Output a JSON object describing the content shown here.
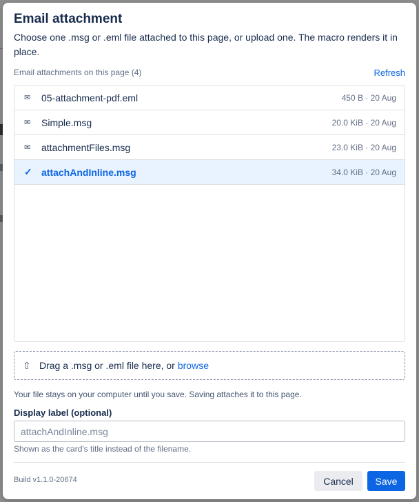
{
  "dialog": {
    "title": "Email attachment",
    "description": "Choose one .msg or .eml file attached to this page, or upload one. The macro renders it in place."
  },
  "attachments": {
    "caption": "Email attachments on this page (4)",
    "refresh_label": "Refresh",
    "items": [
      {
        "icon": "mail-icon",
        "glyph": "✉",
        "name": "05-attachment-pdf.eml",
        "meta": "450 B · 20 Aug",
        "selected": false
      },
      {
        "icon": "mail-icon",
        "glyph": "✉",
        "name": "Simple.msg",
        "meta": "20.0 KiB · 20 Aug",
        "selected": false
      },
      {
        "icon": "mail-icon",
        "glyph": "✉",
        "name": "attachmentFiles.msg",
        "meta": "23.0 KiB · 20 Aug",
        "selected": false
      },
      {
        "icon": "check-icon",
        "glyph": "✓",
        "name": "attachAndInline.msg",
        "meta": "34.0 KiB · 20 Aug",
        "selected": true
      }
    ]
  },
  "upload": {
    "icon": "upload-arrow-icon",
    "glyph": "⇧",
    "prompt": "Drag a .msg or .eml file here, or",
    "browse_label": "browse",
    "note": "Your file stays on your computer until you save. Saving attaches it to this page."
  },
  "label_field": {
    "label": "Display label (optional)",
    "placeholder": "attachAndInline.msg",
    "value": "",
    "help": "Shown as the card's title instead of the filename."
  },
  "footer": {
    "build": "Build v1.1.0-20674",
    "cancel_label": "Cancel",
    "save_label": "Save"
  },
  "colors": {
    "accent": "#0c66e4",
    "selected_row_bg": "#e9f2ff",
    "overlay": "#8e8e8e"
  }
}
